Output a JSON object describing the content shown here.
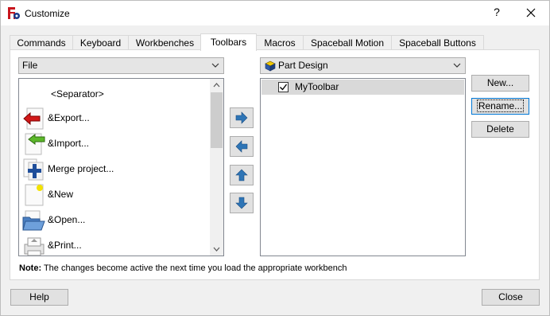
{
  "window": {
    "title": "Customize",
    "help_glyph": "?",
    "close_glyph": "✕"
  },
  "tabs": [
    {
      "label": "Commands"
    },
    {
      "label": "Keyboard"
    },
    {
      "label": "Workbenches"
    },
    {
      "label": "Toolbars",
      "active": true
    },
    {
      "label": "Macros"
    },
    {
      "label": "Spaceball Motion"
    },
    {
      "label": "Spaceball Buttons"
    }
  ],
  "left_panel": {
    "category_combo": "File",
    "commands": [
      {
        "label": "<Separator>",
        "icon": "none"
      },
      {
        "label": "&Export...",
        "icon": "export-icon"
      },
      {
        "label": "&Import...",
        "icon": "import-icon"
      },
      {
        "label": "Merge project...",
        "icon": "merge-icon"
      },
      {
        "label": "&New",
        "icon": "new-document-icon"
      },
      {
        "label": "&Open...",
        "icon": "open-folder-icon"
      },
      {
        "label": "&Print...",
        "icon": "print-icon"
      }
    ]
  },
  "right_panel": {
    "workbench_combo": "Part Design",
    "toolbars": [
      {
        "label": "MyToolbar",
        "checked": true,
        "selected": true
      }
    ]
  },
  "buttons": {
    "new": "New...",
    "rename": "Rename...",
    "delete": "Delete",
    "help": "Help",
    "close": "Close"
  },
  "note": {
    "bold": "Note:",
    "text": " The changes become active the next time you load the appropriate workbench"
  },
  "colors": {
    "accent": "#0078d7",
    "selection": "#d9d9d9",
    "arrow_blue": "#2e75b6"
  }
}
